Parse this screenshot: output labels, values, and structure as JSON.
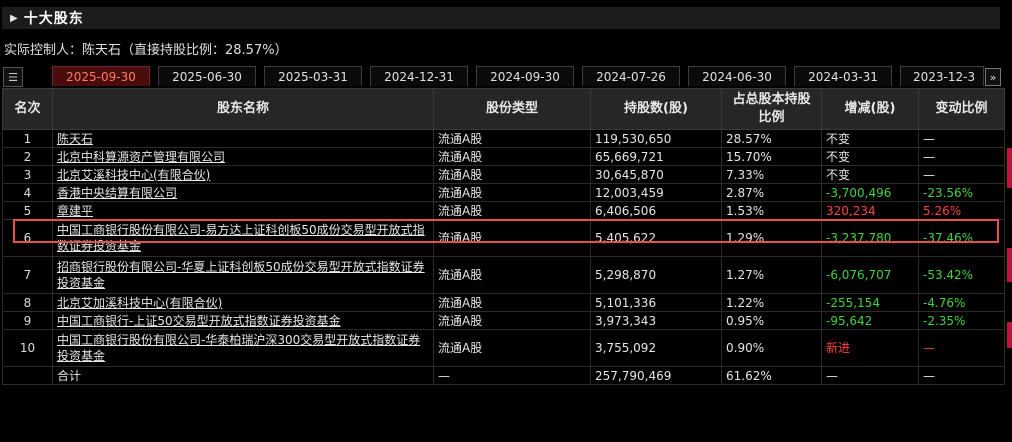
{
  "header": {
    "title": "十大股东"
  },
  "controller": "实际控制人：陈天石（直接持股比例：28.57%）",
  "tabs": [
    "2025-09-30",
    "2025-06-30",
    "2025-03-31",
    "2024-12-31",
    "2024-09-30",
    "2024-07-26",
    "2024-06-30",
    "2024-03-31",
    "2023-12-3"
  ],
  "active_tab": "2025-09-30",
  "table": {
    "headers": [
      "名次",
      "股东名称",
      "股份类型",
      "持股数(股)",
      "占总股本持股比例",
      "增减(股)",
      "变动比例"
    ],
    "rows": [
      {
        "rank": "1",
        "name": "陈天石",
        "type": "流通A股",
        "shares": "119,530,650",
        "pct": "28.57%",
        "change": "不变",
        "ratio": "—",
        "color": "white"
      },
      {
        "rank": "2",
        "name": "北京中科算源资产管理有限公司",
        "type": "流通A股",
        "shares": "65,669,721",
        "pct": "15.70%",
        "change": "不变",
        "ratio": "—",
        "color": "white"
      },
      {
        "rank": "3",
        "name": "北京艾溪科技中心(有限合伙)",
        "type": "流通A股",
        "shares": "30,645,870",
        "pct": "7.33%",
        "change": "不变",
        "ratio": "—",
        "color": "white"
      },
      {
        "rank": "4",
        "name": "香港中央结算有限公司",
        "type": "流通A股",
        "shares": "12,003,459",
        "pct": "2.87%",
        "change": "-3,700,496",
        "ratio": "-23.56%",
        "color": "green"
      },
      {
        "rank": "5",
        "name": "章建平",
        "type": "流通A股",
        "shares": "6,406,506",
        "pct": "1.53%",
        "change": "320,234",
        "ratio": "5.26%",
        "color": "red"
      },
      {
        "rank": "6",
        "name": "中国工商银行股份有限公司-易方达上证科创板50成份交易型开放式指数证券投资基金",
        "type": "流通A股",
        "shares": "5,405,622",
        "pct": "1.29%",
        "change": "-3,237,780",
        "ratio": "-37.46%",
        "color": "green"
      },
      {
        "rank": "7",
        "name": "招商银行股份有限公司-华夏上证科创板50成份交易型开放式指数证券投资基金",
        "type": "流通A股",
        "shares": "5,298,870",
        "pct": "1.27%",
        "change": "-6,076,707",
        "ratio": "-53.42%",
        "color": "green"
      },
      {
        "rank": "8",
        "name": "北京艾加溪科技中心(有限合伙)",
        "type": "流通A股",
        "shares": "5,101,336",
        "pct": "1.22%",
        "change": "-255,154",
        "ratio": "-4.76%",
        "color": "green"
      },
      {
        "rank": "9",
        "name": "中国工商银行-上证50交易型开放式指数证券投资基金",
        "type": "流通A股",
        "shares": "3,973,343",
        "pct": "0.95%",
        "change": "-95,642",
        "ratio": "-2.35%",
        "color": "green"
      },
      {
        "rank": "10",
        "name": "中国工商银行股份有限公司-华泰柏瑞沪深300交易型开放式指数证券投资基金",
        "type": "流通A股",
        "shares": "3,755,092",
        "pct": "0.90%",
        "change": "新进",
        "ratio": "—",
        "color": "red"
      }
    ],
    "total": {
      "label": "合计",
      "type": "—",
      "shares": "257,790,469",
      "pct": "61.62%",
      "change": "—",
      "ratio": "—"
    }
  },
  "highlighted_rank": "5",
  "colors": {
    "increase": "#ff4040",
    "decrease": "#3fd23f",
    "active_tab": "#ff7b5f",
    "highlight_border": "#e8504e"
  }
}
